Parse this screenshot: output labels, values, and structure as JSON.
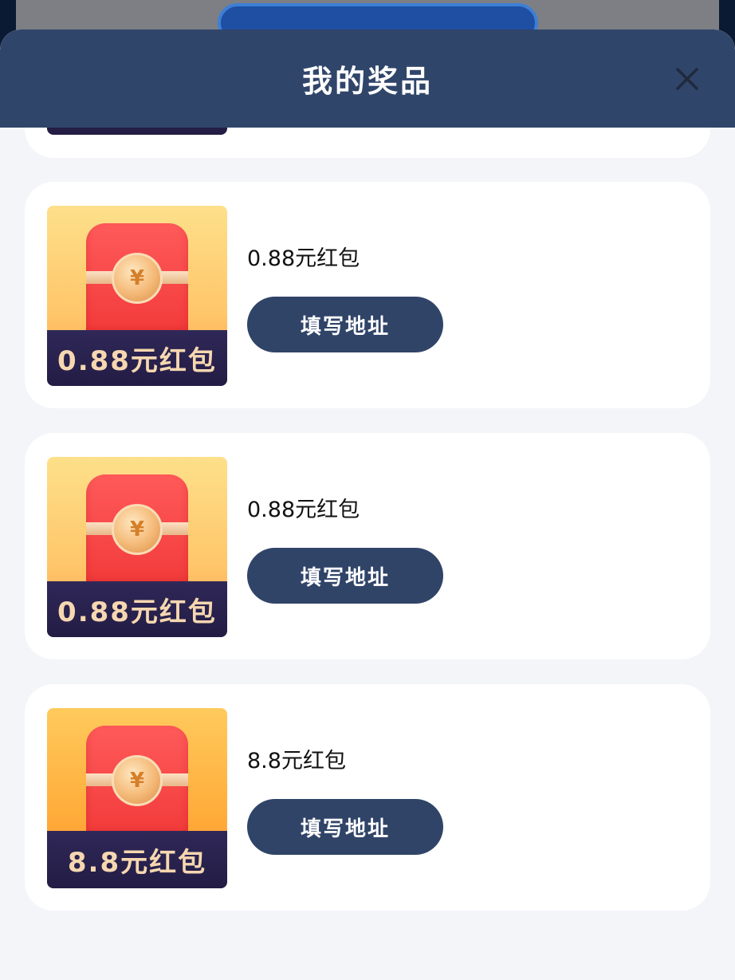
{
  "header": {
    "title": "我的奖品"
  },
  "icons": {
    "close": "close-icon",
    "coin": "yuan-coin-icon"
  },
  "colors": {
    "header_bg": "#30456a",
    "button_bg": "#304468",
    "page_bg": "#f3f5f9"
  },
  "prizes": [
    {
      "name": "0.88元红包",
      "image_label": "0.88元红包",
      "button_label": "填写地址"
    },
    {
      "name": "0.88元红包",
      "image_label": "0.88元红包",
      "button_label": "填写地址"
    },
    {
      "name": "8.8元红包",
      "image_label": "8.8元红包",
      "button_label": "填写地址"
    }
  ],
  "coin_symbol": "¥"
}
